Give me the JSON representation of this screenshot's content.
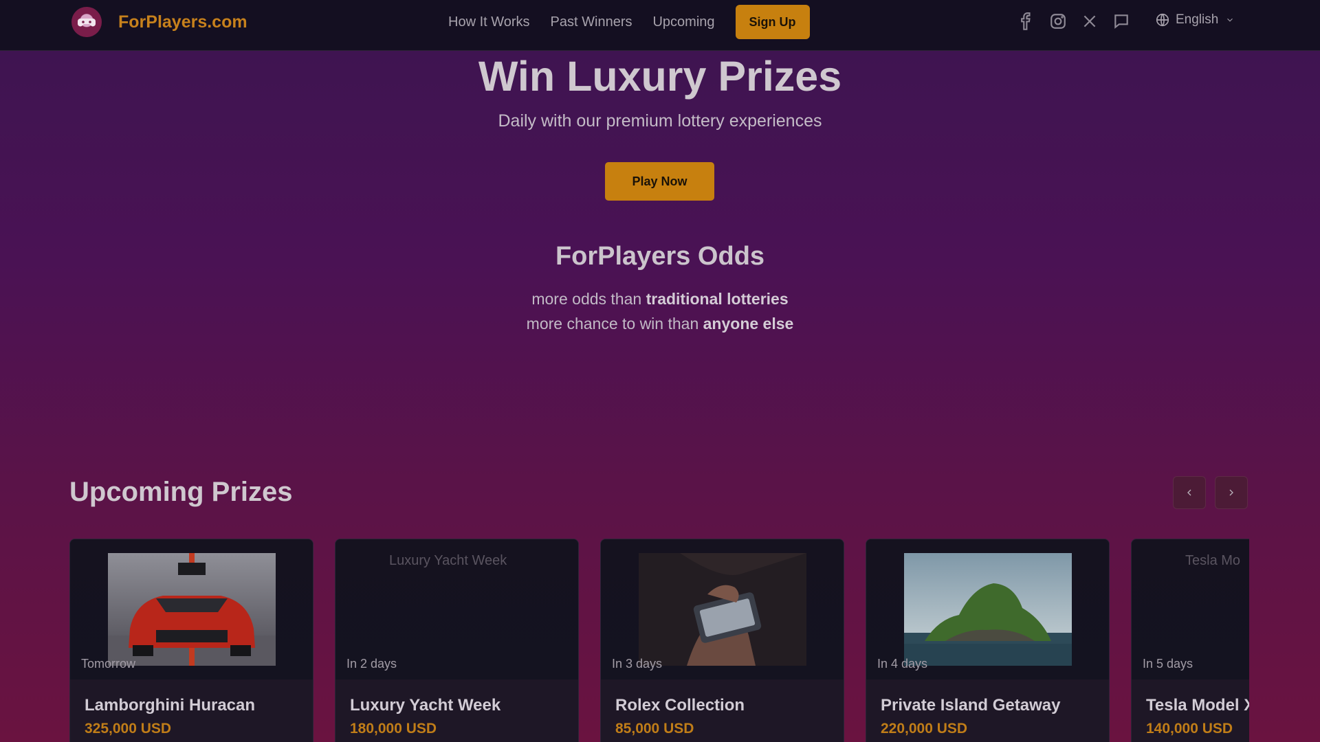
{
  "header": {
    "brand": "ForPlayers.com",
    "nav": [
      "How It Works",
      "Past Winners",
      "Upcoming"
    ],
    "signup_label": "Sign Up",
    "social_icons": [
      "facebook-icon",
      "instagram-icon",
      "x-icon",
      "chat-icon"
    ],
    "language": "English"
  },
  "hero": {
    "title": "Win Luxury Prizes",
    "subtitle": "Daily with our premium lottery experiences",
    "play_label": "Play Now"
  },
  "odds": {
    "title": "ForPlayers Odds",
    "line1_prefix": "more odds than ",
    "line1_bold": "traditional lotteries",
    "line2_prefix": "more chance to win than ",
    "line2_bold": "anyone else"
  },
  "upcoming": {
    "title": "Upcoming Prizes",
    "cards": [
      {
        "when": "Tomorrow",
        "name": "Lamborghini Huracan",
        "price": "325,000 USD"
      },
      {
        "when": "In 2 days",
        "name": "Luxury Yacht Week",
        "price": "180,000 USD",
        "alt": "Luxury Yacht Week"
      },
      {
        "when": "In 3 days",
        "name": "Rolex Collection",
        "price": "85,000 USD"
      },
      {
        "when": "In 4 days",
        "name": "Private Island Getaway",
        "price": "220,000 USD"
      },
      {
        "when": "In 5 days",
        "name": "Tesla Model X",
        "price": "140,000 USD",
        "alt": "Tesla Mo"
      }
    ]
  },
  "colors": {
    "accent": "#c7800f",
    "header_bg": "#140f21",
    "card_bg": "#1e1726"
  }
}
